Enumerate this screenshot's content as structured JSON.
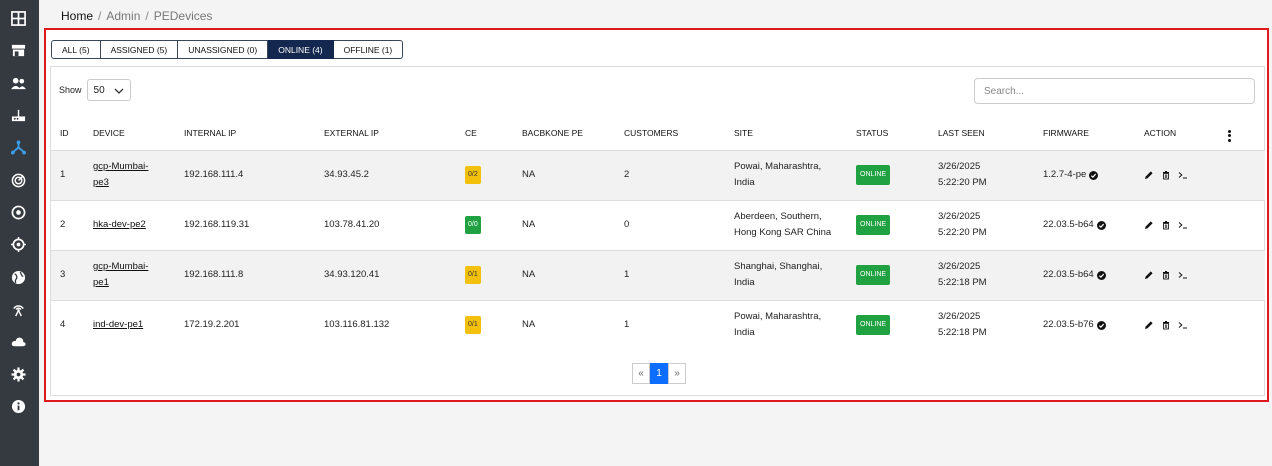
{
  "breadcrumb": {
    "home": "Home",
    "admin": "Admin",
    "current": "PEDevices"
  },
  "tabs": [
    {
      "label": "ALL (5)"
    },
    {
      "label": "ASSIGNED (5)"
    },
    {
      "label": "UNASSIGNED (0)"
    },
    {
      "label": "ONLINE (4)",
      "active": true
    },
    {
      "label": "OFFLINE (1)"
    }
  ],
  "show": {
    "label": "Show",
    "value": "50"
  },
  "search": {
    "placeholder": "Search..."
  },
  "columns": [
    "ID",
    "DEVICE",
    "INTERNAL IP",
    "EXTERNAL IP",
    "CE",
    "BACBKONE PE",
    "CUSTOMERS",
    "SITE",
    "STATUS",
    "LAST SEEN",
    "FIRMWARE",
    "ACTION"
  ],
  "rows": [
    {
      "id": "1",
      "device_l1": "gcp-Mumbai-",
      "device_l2": "pe3",
      "internal_ip": "192.168.111.4",
      "external_ip": "34.93.45.2",
      "ce": "0/2",
      "ce_color": "#f3c10c",
      "backbone": "NA",
      "customers": "2",
      "site_l1": "Powai, Maharashtra,",
      "site_l2": "India",
      "status": "ONLINE",
      "seen_l1": "3/26/2025",
      "seen_l2": "5:22:20 PM",
      "firmware": "1.2.7-4-pe"
    },
    {
      "id": "2",
      "device_l1": "hka-dev-pe2",
      "device_l2": "",
      "internal_ip": "192.168.119.31",
      "external_ip": "103.78.41.20",
      "ce": "0/0",
      "ce_color": "#21a242",
      "backbone": "NA",
      "customers": "0",
      "site_l1": "Aberdeen, Southern,",
      "site_l2": "Hong Kong SAR China",
      "status": "ONLINE",
      "seen_l1": "3/26/2025",
      "seen_l2": "5:22:20 PM",
      "firmware": "22.03.5-b64"
    },
    {
      "id": "3",
      "device_l1": "gcp-Mumbai-",
      "device_l2": "pe1",
      "internal_ip": "192.168.111.8",
      "external_ip": "34.93.120.41",
      "ce": "0/1",
      "ce_color": "#f3c10c",
      "backbone": "NA",
      "customers": "1",
      "site_l1": "Shanghai, Shanghai,",
      "site_l2": "India",
      "status": "ONLINE",
      "seen_l1": "3/26/2025",
      "seen_l2": "5:22:18 PM",
      "firmware": "22.03.5-b64"
    },
    {
      "id": "4",
      "device_l1": "ind-dev-pe1",
      "device_l2": "",
      "internal_ip": "172.19.2.201",
      "external_ip": "103.116.81.132",
      "ce": "0/1",
      "ce_color": "#f3c10c",
      "backbone": "NA",
      "customers": "1",
      "site_l1": "Powai, Maharashtra,",
      "site_l2": "India",
      "status": "ONLINE",
      "seen_l1": "3/26/2025",
      "seen_l2": "5:22:18 PM",
      "firmware": "22.03.5-b76"
    }
  ],
  "pagination": {
    "prev": "«",
    "page": "1",
    "next": "»"
  },
  "colors": {
    "sidebar": "#343a40",
    "active_nav": "#3b9eea",
    "active_tab": "#14284f",
    "status_green": "#21a242",
    "ce_yellow": "#f3c10c",
    "frame_border": "#e0191f",
    "page_active": "#0d6efd"
  },
  "sidebar_icons": [
    "dashboard-grid-icon",
    "store-icon",
    "users-icon",
    "router-icon",
    "network-hub-icon",
    "radar-icon",
    "target-icon",
    "crosshair-icon",
    "globe-icon",
    "antenna-icon",
    "cloud-icon",
    "gear-icon",
    "info-icon"
  ]
}
